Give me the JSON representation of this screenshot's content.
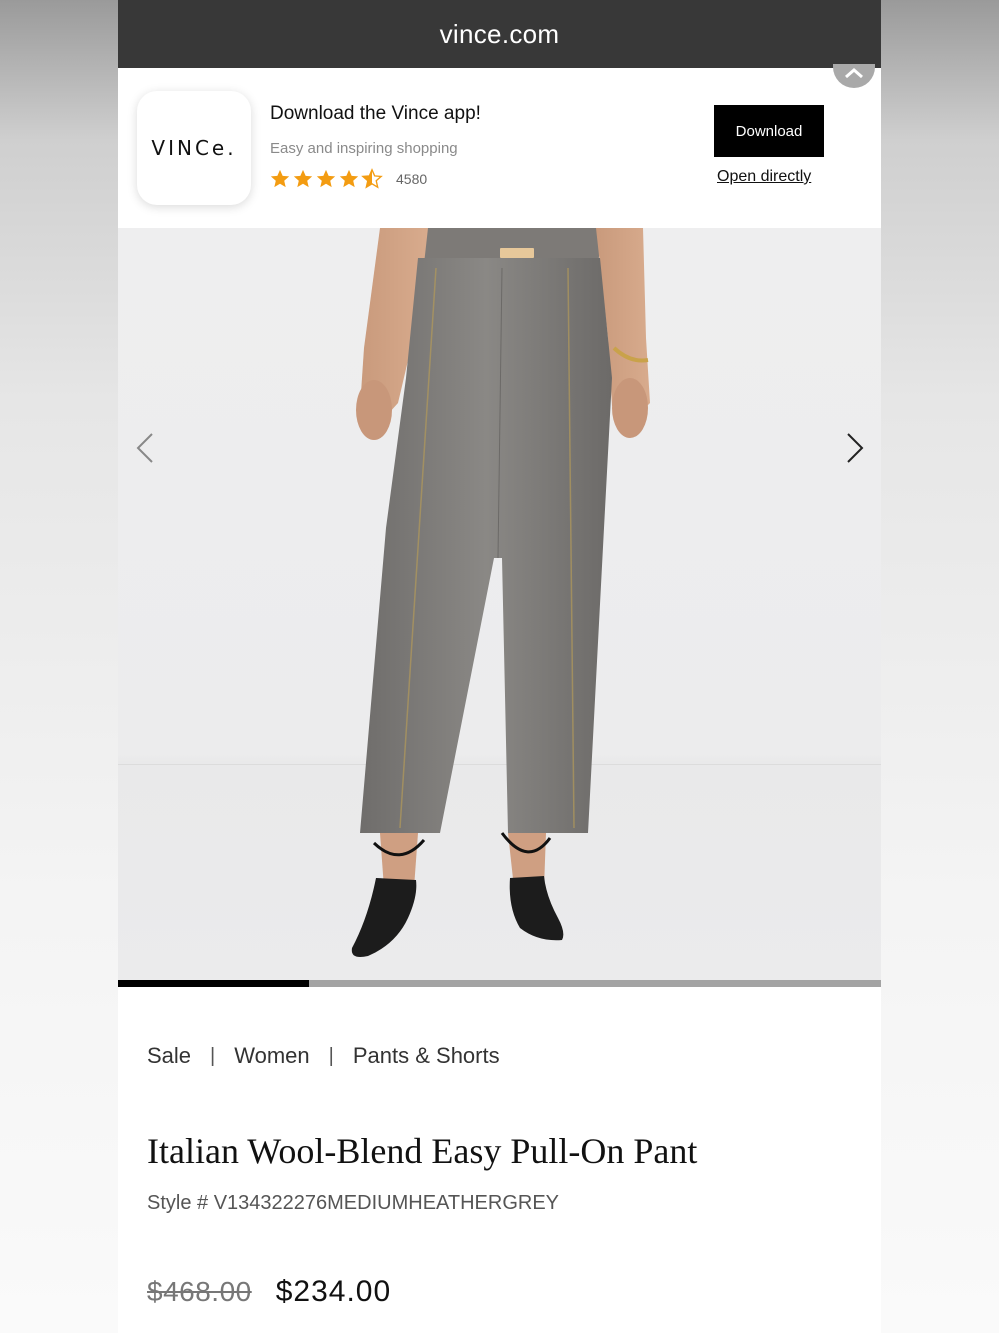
{
  "browser": {
    "url": "vince.com"
  },
  "app_banner": {
    "brand": "VINCe.",
    "title": "Download the Vince app!",
    "subtitle": "Easy and inspiring shopping",
    "rating_stars": 4.5,
    "rating_count": "4580",
    "download_label": "Download",
    "open_label": "Open directly",
    "star_color": "#f39c12"
  },
  "gallery": {
    "image_alt": "Model wearing grey wool-blend pull-on pants with black pointed flats",
    "progress_fraction": 0.25
  },
  "breadcrumb": [
    "Sale",
    "Women",
    "Pants & Shorts"
  ],
  "product": {
    "title": "Italian Wool-Blend Easy Pull-On Pant",
    "style": "Style # V134322276MEDIUMHEATHERGREY",
    "original_price": "$468.00",
    "sale_price": "$234.00"
  }
}
